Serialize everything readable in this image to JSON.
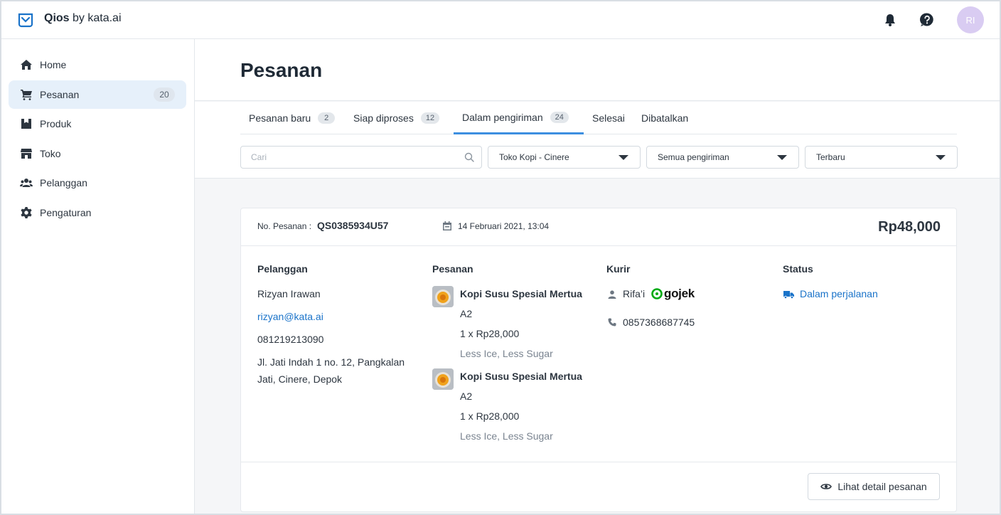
{
  "header": {
    "brand_bold": "Qios",
    "brand_rest": "by kata.ai",
    "avatar_initials": "RI"
  },
  "sidebar": {
    "items": [
      {
        "label": "Home",
        "icon": "home-icon"
      },
      {
        "label": "Pesanan",
        "icon": "cart-icon",
        "badge": "20",
        "active": true
      },
      {
        "label": "Produk",
        "icon": "product-icon"
      },
      {
        "label": "Toko",
        "icon": "store-icon"
      },
      {
        "label": "Pelanggan",
        "icon": "users-icon"
      },
      {
        "label": "Pengaturan",
        "icon": "gear-icon"
      }
    ]
  },
  "page": {
    "title": "Pesanan"
  },
  "tabs": [
    {
      "label": "Pesanan baru",
      "count": "2"
    },
    {
      "label": "Siap diproses",
      "count": "12"
    },
    {
      "label": "Dalam pengiriman",
      "count": "24",
      "active": true
    },
    {
      "label": "Selesai"
    },
    {
      "label": "Dibatalkan"
    }
  ],
  "filters": {
    "search_placeholder": "Cari",
    "store": "Toko Kopi - Cinere",
    "shipping": "Semua pengiriman",
    "sort": "Terbaru"
  },
  "order": {
    "number_label": "No. Pesanan :",
    "number": "QS0385934U57",
    "date": "14 Februari 2021, 13:04",
    "total": "Rp48,000",
    "customer": {
      "title": "Pelanggan",
      "name": "Rizyan Irawan",
      "email": "rizyan@kata.ai",
      "phone": "081219213090",
      "address_line1": "Jl. Jati Indah 1 no. 12, Pangkalan",
      "address_line2": "Jati, Cinere, Depok"
    },
    "items_title": "Pesanan",
    "items": [
      {
        "name": "Kopi Susu Spesial Mertua",
        "variant": "A2",
        "qty_price": "1 x Rp28,000",
        "note": "Less Ice, Less Sugar"
      },
      {
        "name": "Kopi Susu Spesial Mertua",
        "variant": "A2",
        "qty_price": "1 x Rp28,000",
        "note": "Less Ice, Less Sugar"
      }
    ],
    "courier": {
      "title": "Kurir",
      "name": "Rifa’i",
      "service": "gojek",
      "phone": "0857368687745"
    },
    "status": {
      "title": "Status",
      "value": "Dalam perjalanan"
    },
    "detail_button": "Lihat detail pesanan"
  },
  "colors": {
    "accent": "#3d8fe0",
    "link": "#1a73c9",
    "active_nav_bg": "#e6f0fa",
    "gojek_green": "#00aa13",
    "avatar_bg": "#d9ccf2"
  }
}
